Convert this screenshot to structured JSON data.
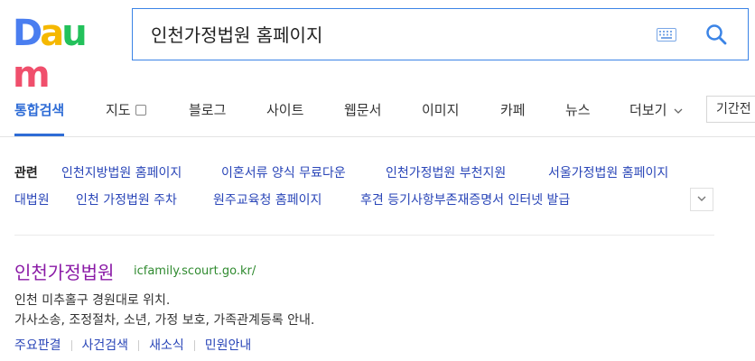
{
  "logo": {
    "text": "Daum",
    "letters": [
      "D",
      "a",
      "u",
      "m"
    ],
    "colors": [
      "#4a7ef0",
      "#f5b800",
      "#23c15b",
      "#f04f6c"
    ]
  },
  "search": {
    "query": "인천가정법원 홈페이지",
    "keyboard_icon": "keyboard-icon",
    "search_icon": "search-icon",
    "accent": "#3b84e6"
  },
  "tabs": [
    {
      "label": "통합검색",
      "active": true
    },
    {
      "label": "지도"
    },
    {
      "label": "블로그"
    },
    {
      "label": "사이트"
    },
    {
      "label": "웹문서"
    },
    {
      "label": "이미지"
    },
    {
      "label": "카페"
    },
    {
      "label": "뉴스"
    },
    {
      "label": "더보기"
    }
  ],
  "period_filter": "기간전",
  "related": {
    "label": "관련",
    "links": [
      "인천지방법원 홈페이지",
      "이혼서류 양식 무료다운",
      "인천가정법원 부천지원",
      "서울가정법원 홈페이지",
      "대법원",
      "인천 가정법원 주차",
      "원주교육청 홈페이지",
      "후견 등기사항부존재증명서 인터넷 발급"
    ]
  },
  "result": {
    "title": "인천가정법원",
    "url": "icfamily.scourt.go.kr/",
    "desc_line1": "인천 미추홀구 경원대로 위치.",
    "desc_line2": "가사소송, 조정절차, 소년, 가정 보호, 가족관계등록 안내.",
    "sublinks": [
      "주요판결",
      "사건검색",
      "새소식",
      "민원안내"
    ]
  }
}
